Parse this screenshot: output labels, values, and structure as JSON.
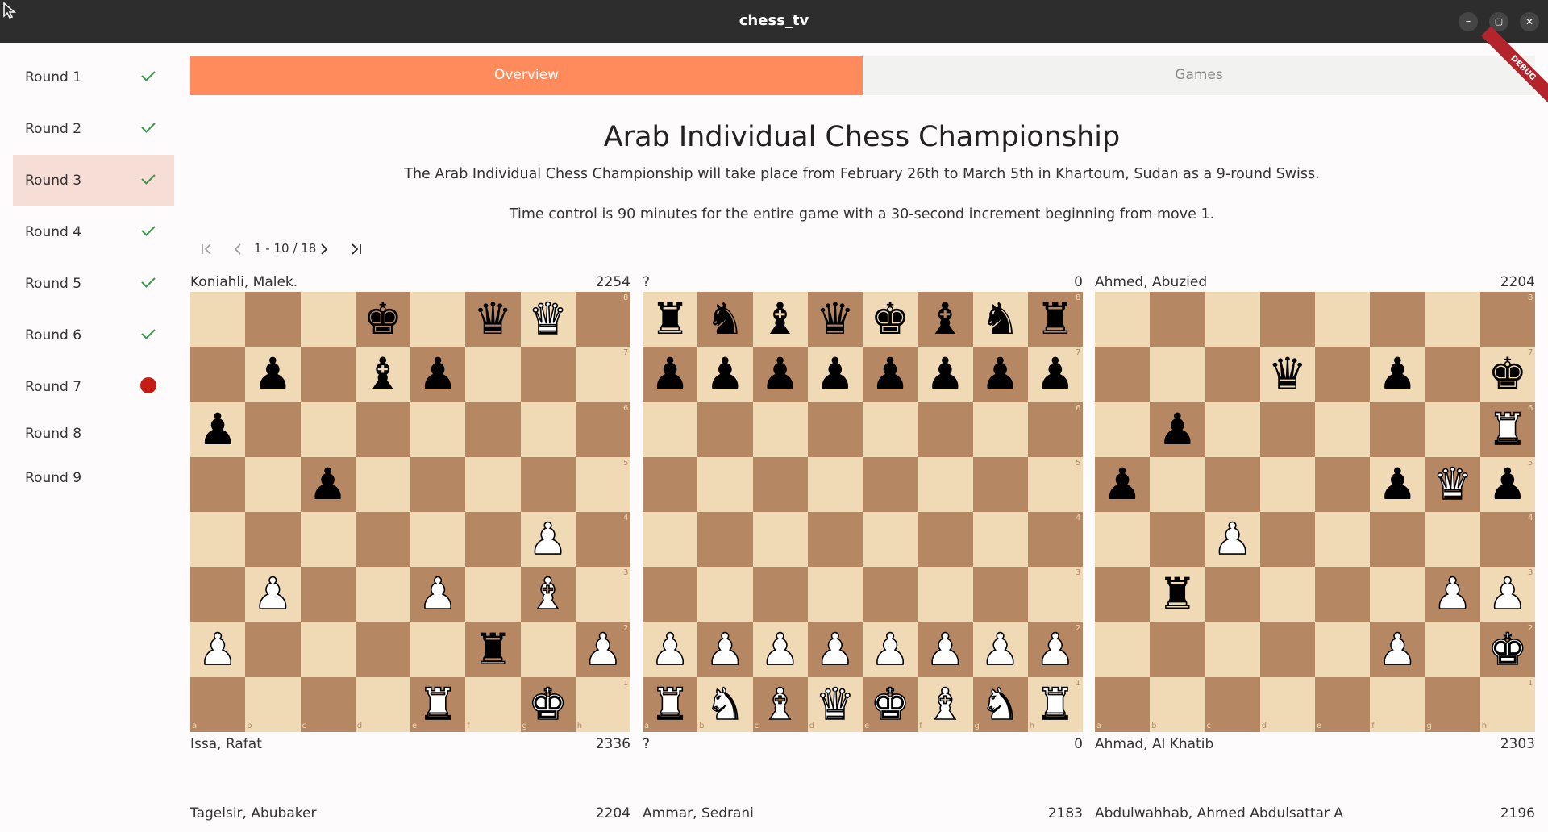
{
  "window": {
    "title": "chess_tv",
    "minimize": "–",
    "maximize": "▢",
    "close": "✕"
  },
  "sidebar": {
    "rounds": [
      {
        "label": "Round 1",
        "status": "done"
      },
      {
        "label": "Round 2",
        "status": "done"
      },
      {
        "label": "Round 3",
        "status": "done",
        "selected": true
      },
      {
        "label": "Round 4",
        "status": "done"
      },
      {
        "label": "Round 5",
        "status": "done"
      },
      {
        "label": "Round 6",
        "status": "done"
      },
      {
        "label": "Round 7",
        "status": "live"
      },
      {
        "label": "Round 8",
        "status": "none"
      },
      {
        "label": "Round 9",
        "status": "none"
      }
    ]
  },
  "tabs": {
    "overview": "Overview",
    "games": "Games",
    "active": "overview"
  },
  "debug_banner": "DEBUG",
  "overview": {
    "title": "Arab Individual Chess Championship",
    "description_1": "The Arab Individual Chess Championship will take place from February 26th to March 5th in Khartoum, Sudan as a 9-round Swiss.",
    "description_2": "Time control is 90 minutes for the entire game with a 30-second increment beginning from move 1."
  },
  "pagination": {
    "label": "1 - 10 / 18",
    "first": "|<",
    "prev": "<",
    "next": ">",
    "last": ">|"
  },
  "board_labels": {
    "files": [
      "a",
      "b",
      "c",
      "d",
      "e",
      "f",
      "g",
      "h"
    ],
    "ranks": [
      "8",
      "7",
      "6",
      "5",
      "4",
      "3",
      "2",
      "1"
    ]
  },
  "games": [
    {
      "top": {
        "name": "Koniahli, Malek.",
        "rating": "2254"
      },
      "bottom": {
        "name": "Issa, Rafat",
        "rating": "2336"
      },
      "position": [
        "3k1qQ1",
        "1p1bp3",
        "p7",
        "2p5",
        "6P1",
        "1P2P1B1",
        "P4r1P",
        "4R1K1"
      ]
    },
    {
      "top": {
        "name": "?",
        "rating": "0"
      },
      "bottom": {
        "name": "?",
        "rating": "0"
      },
      "position": [
        "rnbqkbnr",
        "pppppppp",
        "8",
        "8",
        "8",
        "8",
        "PPPPPPPP",
        "RNBQKBNR"
      ]
    },
    {
      "top": {
        "name": "Ahmed, Abuzied",
        "rating": "2204"
      },
      "bottom": {
        "name": "Ahmad, Al Khatib",
        "rating": "2303"
      },
      "position": [
        "8",
        "3q1p1k",
        "1p5R",
        "p4pQp",
        "2P5",
        "1r4PP",
        "5P1K",
        "8"
      ]
    }
  ],
  "next_row": [
    {
      "name": "Tagelsir, Abubaker",
      "rating": "2204"
    },
    {
      "name": "Ammar, Sedrani",
      "rating": "2183"
    },
    {
      "name": "Abdulwahhab, Ahmed Abdulsattar A",
      "rating": "2196"
    }
  ],
  "colors": {
    "accent": "#ff8a5c",
    "selected_round": "#f6ded6",
    "check": "#2e9e3e",
    "live": "#c41e14",
    "light_square": "#f0d9b5",
    "dark_square": "#b58863"
  }
}
